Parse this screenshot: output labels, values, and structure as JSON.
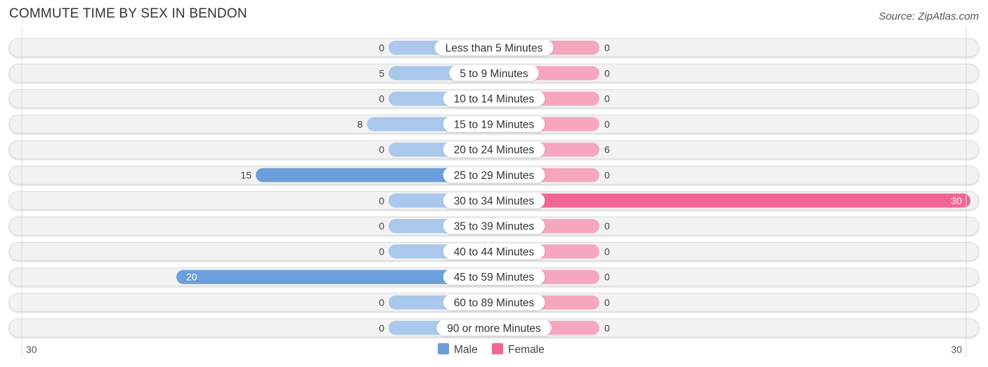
{
  "header": {
    "title": "COMMUTE TIME BY SEX IN BENDON",
    "source": "Source: ZipAtlas.com"
  },
  "colors": {
    "male": "#6a9fdc",
    "male_light": "#a9c8ec",
    "female": "#f06792",
    "female_light": "#f6a7be",
    "row_bg": "#f2f2f2"
  },
  "chart_data": {
    "type": "bar",
    "orientation": "horizontal-diverging",
    "title": "COMMUTE TIME BY SEX IN BENDON",
    "categories": [
      "Less than 5 Minutes",
      "5 to 9 Minutes",
      "10 to 14 Minutes",
      "15 to 19 Minutes",
      "20 to 24 Minutes",
      "25 to 29 Minutes",
      "30 to 34 Minutes",
      "35 to 39 Minutes",
      "40 to 44 Minutes",
      "45 to 59 Minutes",
      "60 to 89 Minutes",
      "90 or more Minutes"
    ],
    "series": [
      {
        "name": "Male",
        "values": [
          0,
          5,
          0,
          8,
          0,
          15,
          0,
          0,
          0,
          20,
          0,
          0
        ]
      },
      {
        "name": "Female",
        "values": [
          0,
          0,
          0,
          0,
          6,
          0,
          30,
          0,
          0,
          0,
          0,
          0
        ]
      }
    ],
    "xlim": [
      -30,
      30
    ],
    "axis_ticks": {
      "left": "30",
      "right": "30"
    },
    "legend": [
      "Male",
      "Female"
    ],
    "legend_position": "bottom-center",
    "grid": false
  }
}
